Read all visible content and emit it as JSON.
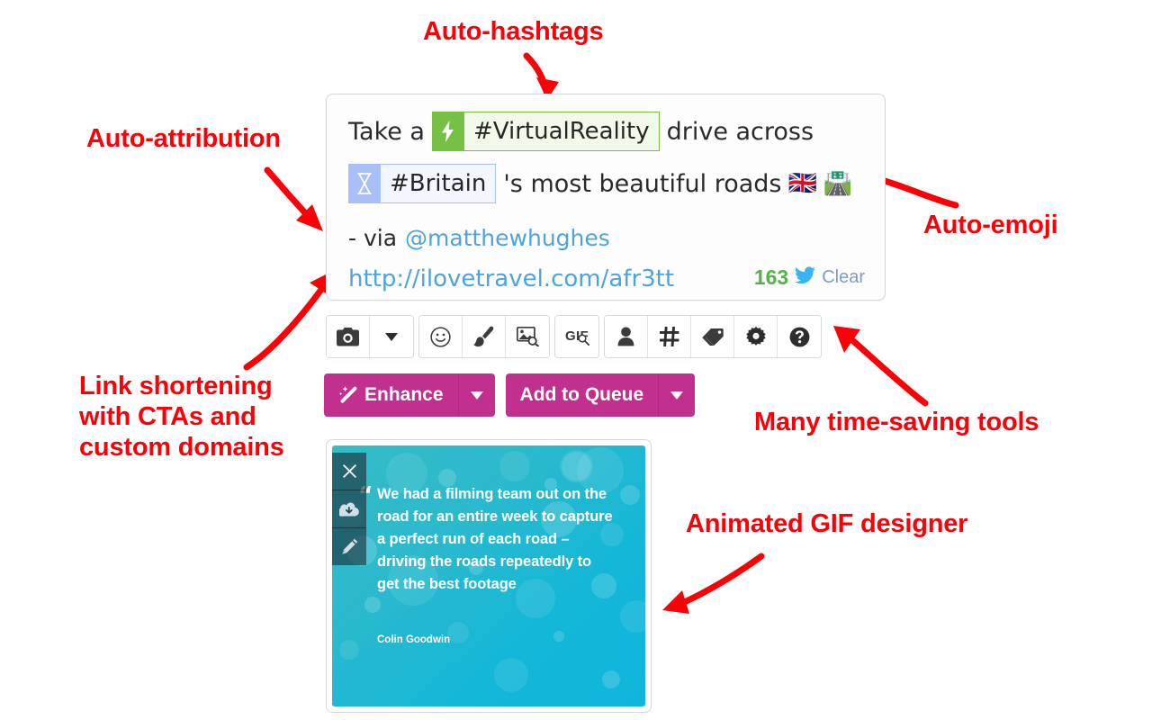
{
  "annotations": [
    {
      "id": "auto-hashtags",
      "label": "Auto-hashtags"
    },
    {
      "id": "auto-attribution",
      "label": "Auto-attribution"
    },
    {
      "id": "auto-emoji",
      "label": "Auto-emoji"
    },
    {
      "id": "link-shortening",
      "label": "Link shortening\nwith CTAs and\ncustom domains"
    },
    {
      "id": "time-saving-tools",
      "label": "Many time-saving tools"
    },
    {
      "id": "gif-designer",
      "label": "Animated GIF designer"
    }
  ],
  "annotation_color": "#fb0007",
  "composer": {
    "line1": {
      "prefix": "Take a",
      "hashtag": "#VirtualReality",
      "hashtag_icon": "lightning-bolt-icon",
      "suffix": "drive across"
    },
    "line2": {
      "hashtag": "#Britain",
      "hashtag_icon": "hourglass-icon",
      "text": "'s most beautiful roads",
      "emoji": [
        "🇬🇧",
        "🛣️"
      ],
      "emoji_names": [
        "uk-flag-emoji",
        "motorway-emoji"
      ]
    },
    "line3": {
      "prefix": "- via",
      "mention": "@matthewhughes"
    },
    "line4": {
      "url": "http://ilovetravel.com/afr3tt"
    },
    "counter": {
      "count": "163",
      "network_icon": "twitter-bird-icon",
      "clear_label": "Clear",
      "count_color": "#57b04e"
    },
    "chip_colors": {
      "green_badge": "#76c043",
      "green_fill": "#f1faea",
      "blue_badge": "#a8c0f7",
      "blue_fill": "#f2f6fe"
    }
  },
  "toolbar": {
    "groups": [
      {
        "buttons": [
          {
            "name": "camera-icon",
            "label": "Add image"
          },
          {
            "name": "chevron-down-icon",
            "label": "Image options"
          }
        ]
      },
      {
        "buttons": [
          {
            "name": "smiley-icon",
            "label": "Emoji"
          },
          {
            "name": "paintbrush-icon",
            "label": "Design"
          },
          {
            "name": "image-search-icon",
            "label": "Image search"
          }
        ]
      },
      {
        "buttons": [
          {
            "name": "gif-search-icon",
            "label": "GIF search",
            "text": "GIF"
          }
        ]
      },
      {
        "buttons": [
          {
            "name": "person-icon",
            "label": "Mention"
          },
          {
            "name": "hashtag-icon",
            "label": "Hashtag"
          },
          {
            "name": "tag-icon",
            "label": "Tag"
          },
          {
            "name": "gear-icon",
            "label": "Settings"
          },
          {
            "name": "help-icon",
            "label": "Help"
          }
        ]
      }
    ]
  },
  "actions": {
    "enhance_label": "Enhance",
    "enhance_icon": "magic-wand-icon",
    "enhance_caret_icon": "chevron-down-icon",
    "queue_label": "Add to Queue",
    "queue_caret_icon": "chevron-down-icon",
    "button_color": "#c12f8f"
  },
  "gif_designer": {
    "quote_mark": "“",
    "quote": "We had a filming team out on the road for an entire week to capture a perfect run of each road – driving the roads repeatedly to get the best footage",
    "author": "Colin Goodwin",
    "tools": [
      {
        "name": "close-icon",
        "label": "Remove"
      },
      {
        "name": "cloud-download-icon",
        "label": "Download"
      },
      {
        "name": "pencil-icon",
        "label": "Edit"
      }
    ],
    "gradient_from": "#35bcc6",
    "gradient_to": "#0fb5dc"
  }
}
